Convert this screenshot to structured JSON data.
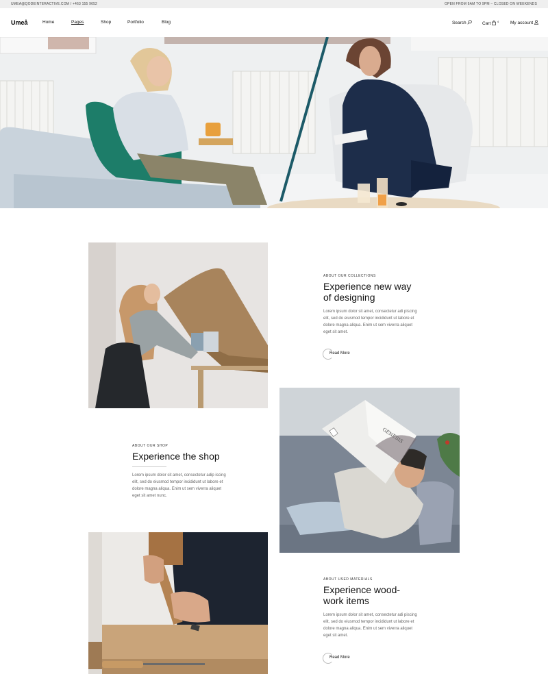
{
  "topbar": {
    "contact": "UMEA@QODEINTERACTIVE.COM / +463 155 9652",
    "hours": "OPEN FROM 9AM TO 9PM – CLOSED ON WEEKENDS"
  },
  "header": {
    "logo": "Umeå",
    "nav": [
      "Home",
      "Pages",
      "Shop",
      "Portfolio",
      "Blog"
    ],
    "search_label": "Search",
    "cart_label": "Cart",
    "cart_count": "4",
    "account_label": "My account"
  },
  "sections": [
    {
      "eyebrow": "ABOUT OUR COLLECTIONS",
      "title_line1": "Experience new way",
      "title_line2": "of designing",
      "body": "Lorem ipsum dolor sit amet, consectetur adi piscing elit, sed do eiusmod tempor incididunt ut labore et dolore magna aliqua. Enim ut sem viverra aliquet eget sit amet.",
      "cta": "Read More"
    },
    {
      "eyebrow": "ABOUT OUR SHOP",
      "title_line1": "Experience the shop",
      "body": "Lorem ipsum dolor sit amet, consectetur adip iscing elit, sed do eiusmod tempor incididunt ut labore et dolore magna aliqua. Enim ut sem viverra aliquet eget sit amet nunc."
    },
    {
      "eyebrow": "ABOUT USED MATERIALS",
      "title_line1": "Experience wood-",
      "title_line2": "work items",
      "body": "Lorem ipsum dolor sit amet, consectetur adi piscing elit, sed do eiusmod tempor incididunt ut labore et dolore magna aliqua. Enim ut sem viverra aliquet eget sit amet.",
      "cta": "Read More"
    }
  ],
  "images": {
    "book_cover_text": "GENESIS"
  },
  "colors": {
    "topbar_bg": "#efefef",
    "text": "#111111",
    "muted": "#666666"
  }
}
